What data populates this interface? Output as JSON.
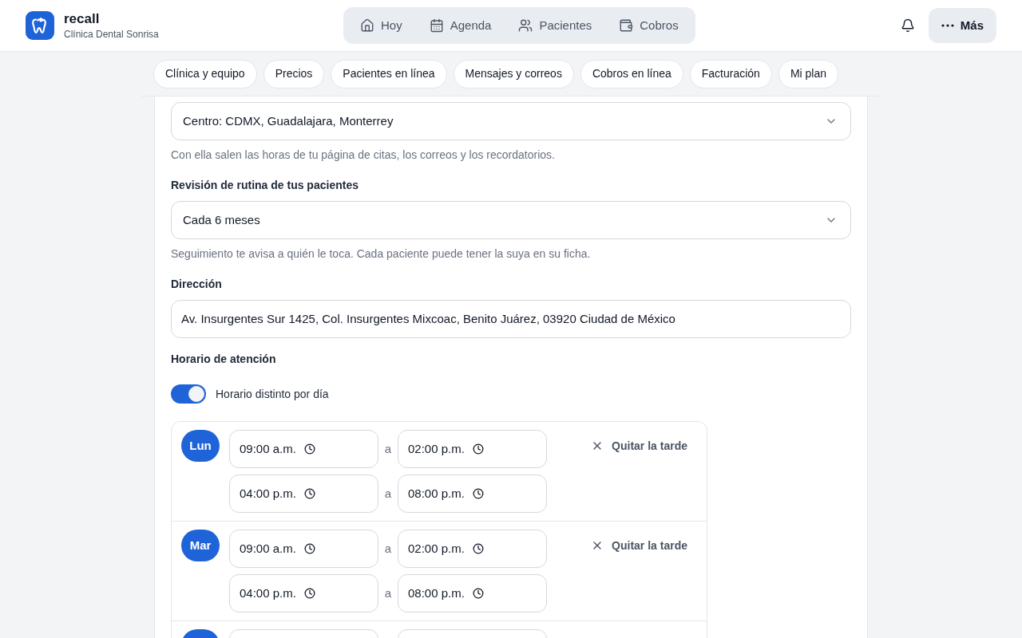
{
  "header": {
    "brand": "recall",
    "clinic": "Clínica Dental Sonrisa",
    "nav": [
      {
        "label": "Hoy"
      },
      {
        "label": "Agenda"
      },
      {
        "label": "Pacientes"
      },
      {
        "label": "Cobros"
      }
    ],
    "more": "Más"
  },
  "settings_tabs": [
    {
      "label": "Clínica y equipo"
    },
    {
      "label": "Precios"
    },
    {
      "label": "Pacientes en línea"
    },
    {
      "label": "Mensajes y correos"
    },
    {
      "label": "Cobros en línea"
    },
    {
      "label": "Facturación"
    },
    {
      "label": "Mi plan"
    }
  ],
  "form": {
    "timezone": {
      "value": "Centro: CDMX, Guadalajara, Monterrey",
      "hint": "Con ella salen las horas de tu página de citas, los correos y los recordatorios."
    },
    "recall": {
      "label": "Revisión de rutina de tus pacientes",
      "value": "Cada 6 meses",
      "hint": "Seguimiento te avisa a quién le toca. Cada paciente puede tener la suya en su ficha."
    },
    "address": {
      "label": "Dirección",
      "value": "Av. Insurgentes Sur 1425, Col. Insurgentes Mixcoac, Benito Juárez, 03920 Ciudad de México"
    },
    "hours": {
      "label": "Horario de atención",
      "per_day": {
        "label": "Horario distinto por día",
        "on": true
      },
      "days": [
        {
          "day": "Lun",
          "shifts": [
            {
              "from": "09:00 a.m.",
              "joiner": "a",
              "to": "02:00 p.m."
            },
            {
              "from": "04:00 p.m.",
              "joiner": "a",
              "to": "08:00 p.m."
            }
          ],
          "remove_label": "Quitar la tarde"
        },
        {
          "day": "Mar",
          "shifts": [
            {
              "from": "09:00 a.m.",
              "joiner": "a",
              "to": "02:00 p.m."
            },
            {
              "from": "04:00 p.m.",
              "joiner": "a",
              "to": "08:00 p.m."
            }
          ],
          "remove_label": "Quitar la tarde"
        }
      ],
      "next_row_cut_off": true
    }
  }
}
